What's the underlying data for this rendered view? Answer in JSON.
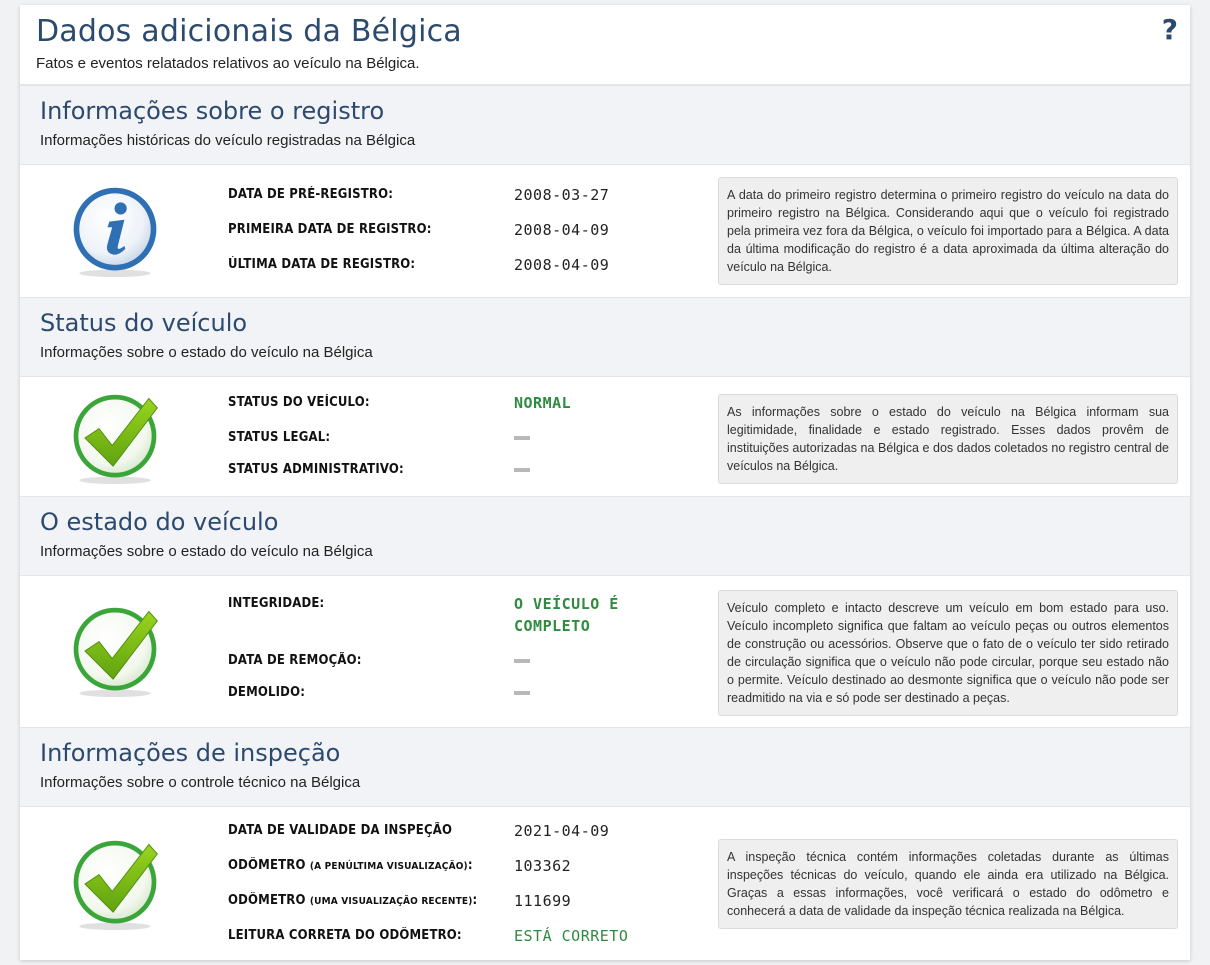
{
  "page": {
    "title": "Dados adicionais da Bélgica",
    "subtitle": "Fatos e eventos relatados relativos ao veículo na Bélgica.",
    "help": "?"
  },
  "sections": [
    {
      "title": "Informações sobre o registro",
      "subtitle": "Informações históricas do veículo registradas na Bélgica",
      "icon": "info-icon",
      "fields": [
        {
          "label": "DATA DE PRÉ-REGISTRO:",
          "value": "2008-03-27"
        },
        {
          "label": "PRIMEIRA DATA DE REGISTRO:",
          "value": "2008-04-09"
        },
        {
          "label": "ÚLTIMA DATA DE REGISTRO:",
          "value": "2008-04-09"
        }
      ],
      "note": "A data do primeiro registro determina o primeiro registro do veículo na data do primeiro registro na Bélgica. Considerando aqui que o veículo foi registrado pela primeira vez fora da Bélgica, o veículo foi importado para a Bélgica. A data da última modificação do registro é a data aproximada da última alteração do veículo na Bélgica."
    },
    {
      "title": "Status do veículo",
      "subtitle": "Informações sobre o estado do veículo na Bélgica",
      "icon": "checkmark-icon",
      "fields": [
        {
          "label": "STATUS DO VEÍCULO:",
          "value": "NORMAL"
        },
        {
          "label": "STATUS LEGAL:",
          "value": "—"
        },
        {
          "label": "STATUS ADMINISTRATIVO:",
          "value": "—"
        }
      ],
      "note": "As informações sobre o estado do veículo na Bélgica informam sua legitimidade, finalidade e estado registrado. Esses dados provêm de instituições autorizadas na Bélgica e dos dados coletados no registro central de veículos na Bélgica."
    },
    {
      "title": "O estado do veículo",
      "subtitle": "Informações sobre o estado do veículo na Bélgica",
      "icon": "checkmark-icon",
      "fields": [
        {
          "label": "INTEGRIDADE:",
          "value_line1": "O VEÍCULO É",
          "value_line2": "COMPLETO"
        },
        {
          "label": "DATA DE REMOÇÃO:",
          "value": "—"
        },
        {
          "label": "DEMOLIDO:",
          "value": "—"
        }
      ],
      "note": "Veículo completo e intacto descreve um veículo em bom estado para uso. Veículo incompleto significa que faltam ao veículo peças ou outros elementos de construção ou acessórios. Observe que o fato de o veículo ter sido retirado de circulação significa que o veículo não pode circular, porque seu estado não o permite. Veículo destinado ao desmonte significa que o veículo não pode ser readmitido na via e só pode ser destinado a peças."
    },
    {
      "title": "Informações de inspeção",
      "subtitle": "Informações sobre o controle técnico na Bélgica",
      "icon": "checkmark-icon",
      "fields": [
        {
          "label": "DATA DE VALIDADE DA INSPEÇÃO",
          "value": "2021-04-09"
        },
        {
          "label": "ODÔMETRO",
          "label_small": "(A PENÚLTIMA VISUALIZAÇÃO)",
          "label_suffix": ":",
          "value": "103362"
        },
        {
          "label": "ODÔMETRO",
          "label_small": "(UMA VISUALIZAÇÃO RECENTE)",
          "label_suffix": ":",
          "value": "111699"
        },
        {
          "label": "LEITURA CORRETA DO ODÔMETRO:",
          "value": "ESTÁ CORRETO"
        }
      ],
      "note": "A inspeção técnica contém informações coletadas durante as últimas inspeções técnicas do veículo, quando ele ainda era utilizado na Bélgica. Graças a essas informações, você verificará o estado do odômetro e conhecerá a data de validade da inspeção técnica realizada na Bélgica."
    }
  ],
  "colors": {
    "title": "#2c4a6e",
    "green_value": "#2e8b3f",
    "section_header_bg": "#f2f3f6",
    "note_bg": "#efefef"
  }
}
